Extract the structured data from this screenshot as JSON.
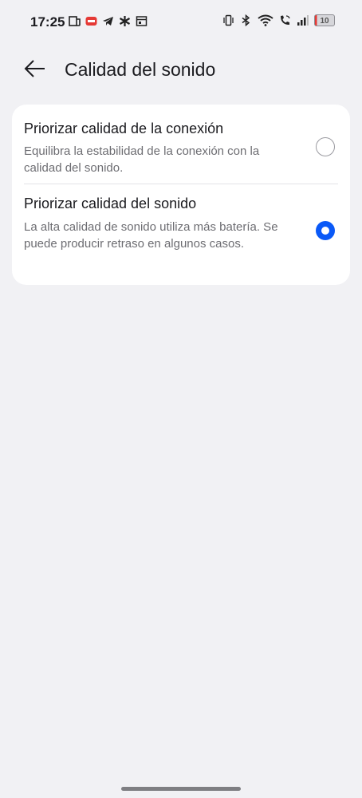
{
  "status_bar": {
    "time": "17:25",
    "battery_level": "10",
    "left_icons": [
      "news-icon",
      "app-red-badge-icon",
      "telegram-icon",
      "gear-flower-icon",
      "calendar-icon"
    ],
    "right_icons": [
      "vibrate-icon",
      "bluetooth-icon",
      "wifi-icon",
      "wifi-call-icon",
      "signal-icon",
      "battery-icon"
    ]
  },
  "header": {
    "back_icon": "arrow-left-icon",
    "title": "Calidad del sonido"
  },
  "options": [
    {
      "title": "Priorizar calidad de la conexión",
      "description": "Equilibra la estabilidad de la conexión con la calidad del sonido.",
      "selected": false
    },
    {
      "title": "Priorizar calidad del sonido",
      "description": "La alta calidad de sonido utiliza más batería. Se puede producir retraso en algunos casos.",
      "selected": true
    }
  ],
  "colors": {
    "accent": "#0a59f7",
    "background": "#f1f1f4",
    "card": "#ffffff",
    "battery_low": "#e53935"
  }
}
